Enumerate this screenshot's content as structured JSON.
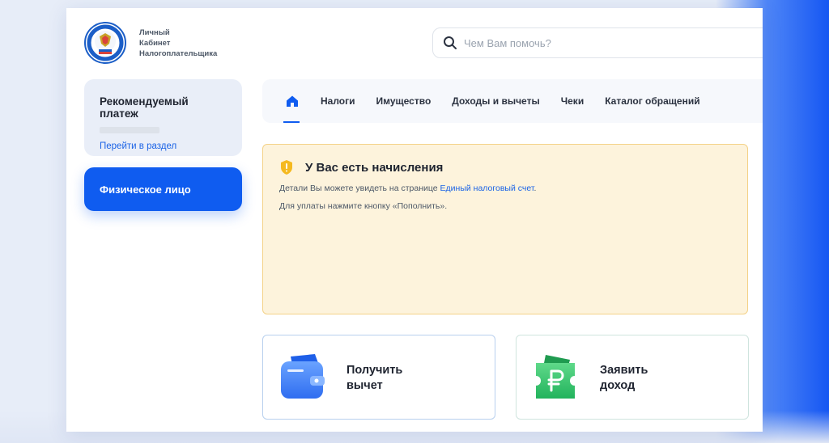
{
  "header": {
    "brand_lines": [
      "Личный",
      "Кабинет",
      "Налогоплательщика"
    ],
    "search": {
      "placeholder": "Чем Вам помочь?"
    }
  },
  "sidebar": {
    "recommended_payment": {
      "title": "Рекомендуемый платеж",
      "link": "Перейти в раздел"
    },
    "person_button": "Физическое лицо"
  },
  "nav": {
    "home_icon": "home-icon",
    "items": [
      "Налоги",
      "Имущество",
      "Доходы и вычеты",
      "Чеки",
      "Каталог обращений"
    ]
  },
  "alert": {
    "icon": "shield-warning-icon",
    "title": "У Вас есть начисления",
    "line1_prefix": "Детали Вы можете увидеть на странице ",
    "line1_link": "Единый налоговый счет",
    "line1_suffix": ".",
    "line2": "Для уплаты нажмите кнопку «Пополнить»."
  },
  "cards": [
    {
      "label_line1": "Получить",
      "label_line2": "вычет",
      "icon": "wallet-icon"
    },
    {
      "label_line1": "Заявить",
      "label_line2": "доход",
      "icon": "ruble-ticket-icon"
    }
  ],
  "colors": {
    "accent": "#0f5cf0",
    "link": "#1b63e6",
    "alert_bg": "#fdf3dc",
    "alert_border": "#f4d288",
    "sidebar_card_bg": "#e9eef8"
  }
}
